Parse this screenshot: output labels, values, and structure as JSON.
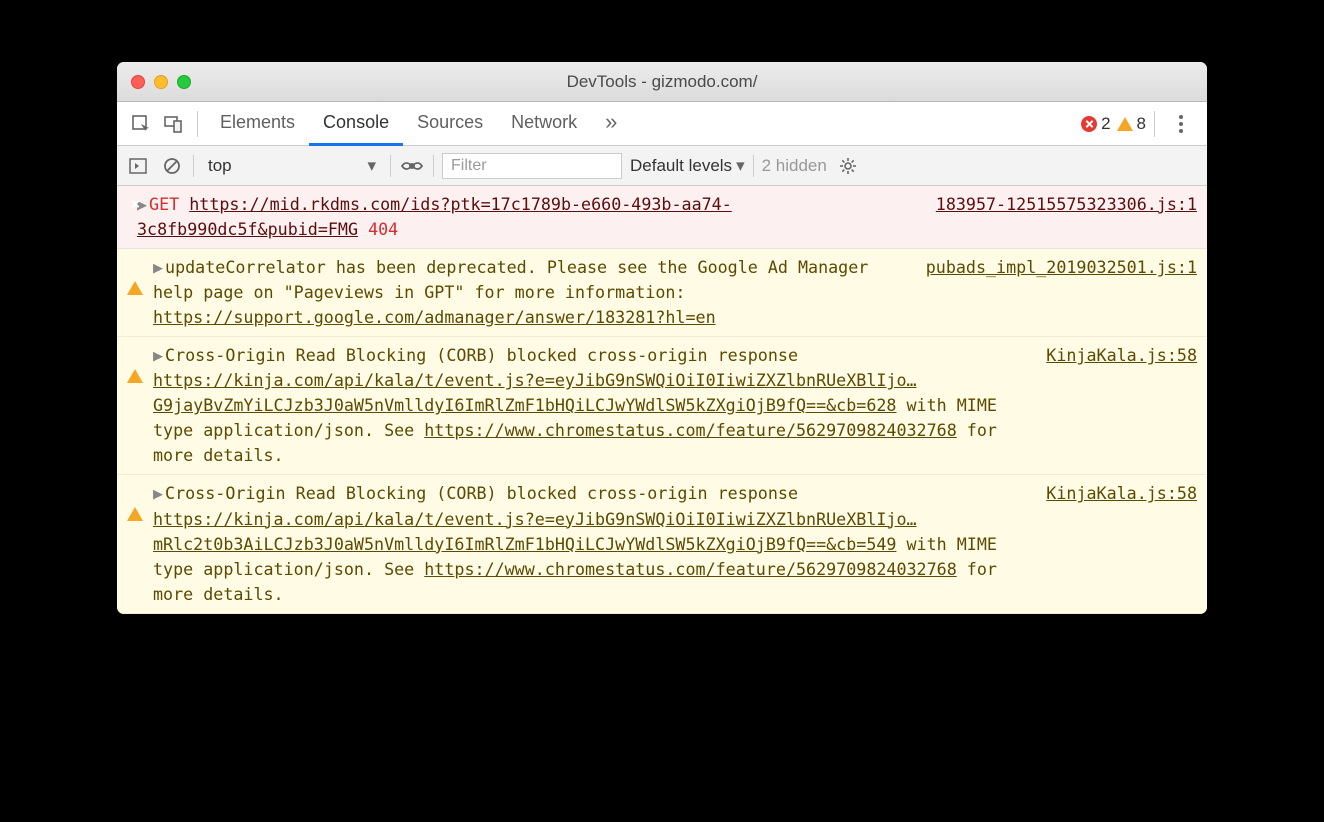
{
  "window_title": "DevTools - gizmodo.com/",
  "tabs": [
    "Elements",
    "Console",
    "Sources",
    "Network"
  ],
  "active_tab": "Console",
  "error_count": "2",
  "warning_count": "8",
  "toolbar": {
    "context": "top",
    "filter_placeholder": "Filter",
    "levels": "Default levels",
    "hidden": "2 hidden"
  },
  "messages": [
    {
      "type": "error",
      "method": "GET",
      "url": "https://mid.rkdms.com/ids?ptk=17c1789b-e660-493b-aa74-3c8fb990dc5f&pubid=FMG",
      "status": "404",
      "source": "183957-12515575323306.js:1"
    },
    {
      "type": "warning",
      "text_pre": "updateCorrelator has been deprecated. Please see the Google Ad Manager help page on \"Pageviews in GPT\" for more information: ",
      "link": "https://support.google.com/admanager/answer/183281?hl=en",
      "source": "pubads_impl_2019032501.js:1"
    },
    {
      "type": "warning",
      "text_pre": "Cross-Origin Read Blocking (CORB) blocked cross-origin response ",
      "link": "https://kinja.com/api/kala/t/event.js?e=eyJibG9nSWQiOiI0IiwiZXZlbnRUeXBlIjo…G9jayBvZmYiLCJzb3J0aW5nVmlldyI6ImRlZmF1bHQiLCJwYWdlSW5kZXgiOjB9fQ==&cb=628",
      "text_mid": " with MIME type application/json. See ",
      "link2": "https://www.chromestatus.com/feature/5629709824032768",
      "text_post": " for more details.",
      "source": "KinjaKala.js:58"
    },
    {
      "type": "warning",
      "text_pre": "Cross-Origin Read Blocking (CORB) blocked cross-origin response ",
      "link": "https://kinja.com/api/kala/t/event.js?e=eyJibG9nSWQiOiI0IiwiZXZlbnRUeXBlIjo…mRlc2t0b3AiLCJzb3J0aW5nVmlldyI6ImRlZmF1bHQiLCJwYWdlSW5kZXgiOjB9fQ==&cb=549",
      "text_mid": " with MIME type application/json. See ",
      "link2": "https://www.chromestatus.com/feature/5629709824032768",
      "text_post": " for more details.",
      "source": "KinjaKala.js:58"
    }
  ]
}
